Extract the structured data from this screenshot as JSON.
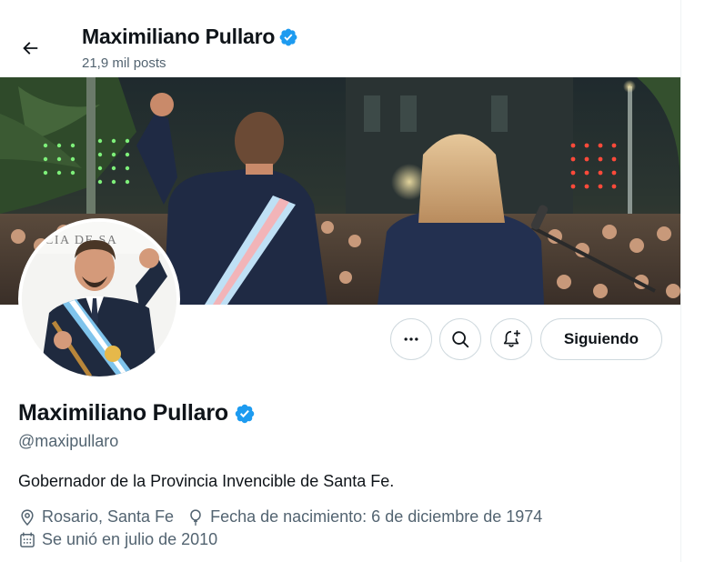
{
  "header": {
    "name": "Maximiliano Pullaro",
    "posts_count": "21,9 mil posts"
  },
  "profile": {
    "name": "Maximiliano Pullaro",
    "handle": "@maxipullaro",
    "bio": "Gobernador de la Provincia Invencible de Santa Fe.",
    "location": "Rosario, Santa Fe",
    "birthdate": "Fecha de nacimiento: 6 de diciembre de 1974",
    "joined": "Se unió en julio de 2010",
    "verified": true
  },
  "banner": {
    "podium_sign": "CIA DE SA"
  },
  "actions": {
    "follow_label": "Siguiendo"
  },
  "colors": {
    "verified_blue": "#1d9bf0",
    "secondary_text": "#536471",
    "border": "#cfd9de"
  }
}
